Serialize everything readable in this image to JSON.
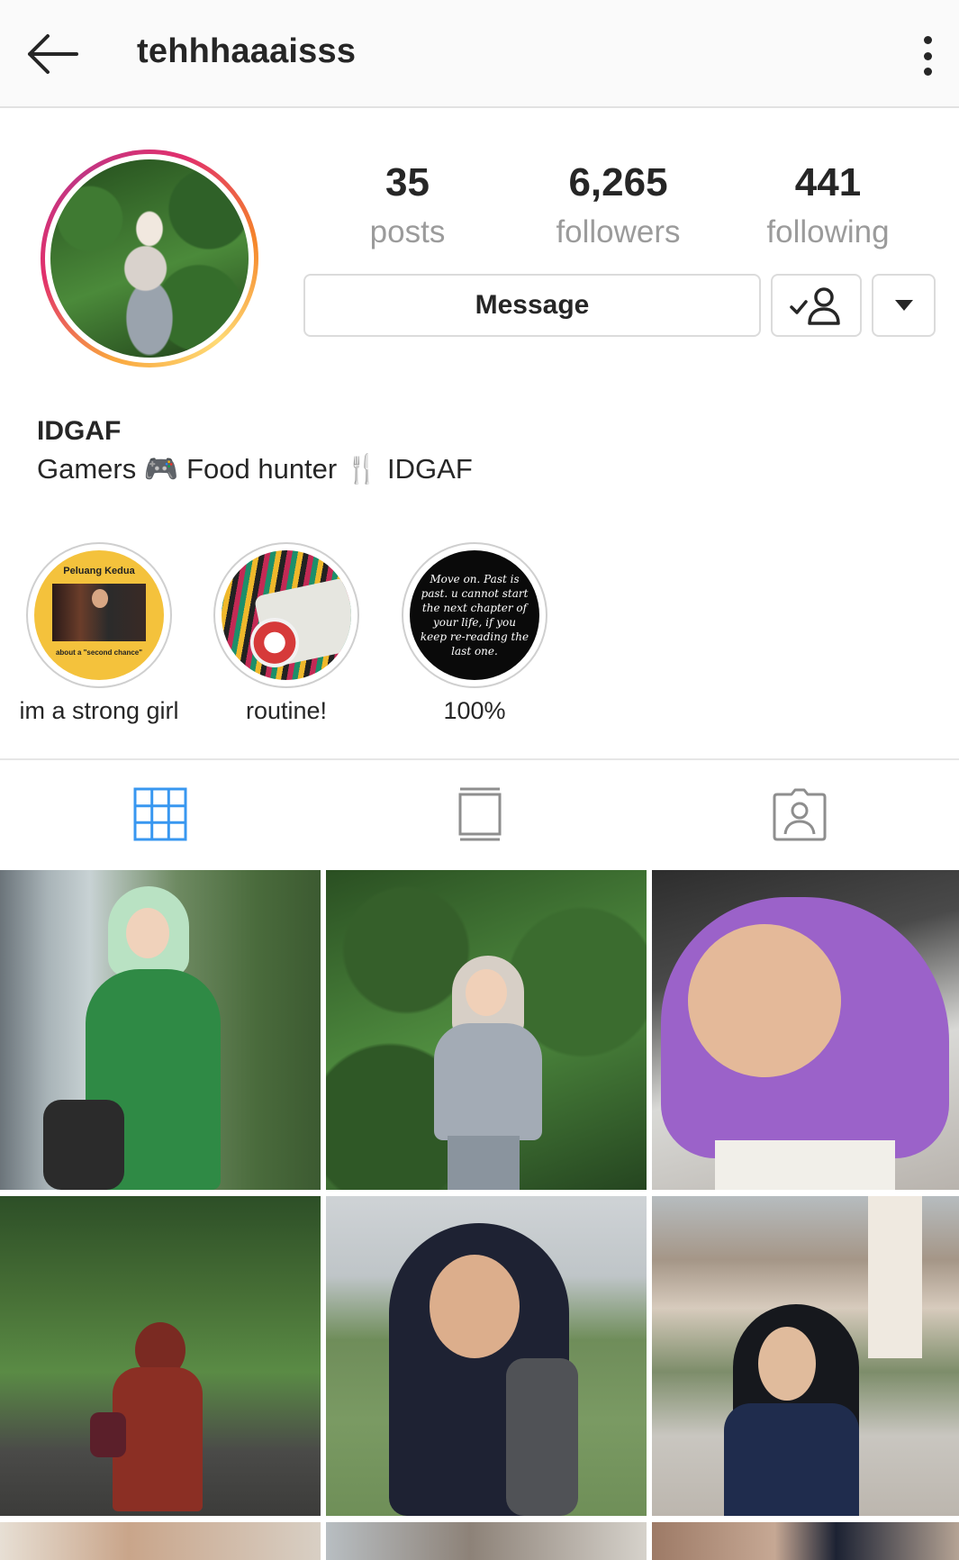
{
  "header": {
    "username": "tehhhaaaisss",
    "back_icon": "arrow-left-icon",
    "more_icon": "more-vertical-icon"
  },
  "profile": {
    "stats": [
      {
        "value": "35",
        "label": "posts"
      },
      {
        "value": "6,265",
        "label": "followers"
      },
      {
        "value": "441",
        "label": "following"
      }
    ],
    "message_label": "Message",
    "following_icon": "person-check-icon",
    "dropdown_icon": "caret-down-icon",
    "name": "IDGAF",
    "bio": "Gamers 🎮 Food hunter 🍴 IDGAF"
  },
  "highlights": [
    {
      "label": "im a strong girl",
      "cover_title": "Peluang Kedua",
      "cover_caption": "about a \"second chance\""
    },
    {
      "label": "routine!"
    },
    {
      "label": "100%",
      "cover_text": "Move on. Past is past. u cannot start the next chapter of your life, if you keep re-reading the last one."
    }
  ],
  "tabs": [
    {
      "name": "grid",
      "icon": "grid-icon",
      "active": true
    },
    {
      "name": "feed",
      "icon": "feed-icon",
      "active": false
    },
    {
      "name": "tagged",
      "icon": "tagged-person-icon",
      "active": false
    }
  ],
  "colors": {
    "active_tab": "#3897f0",
    "inactive_tab": "#8e8e8e",
    "ring_start": "#f9a73e",
    "ring_end": "#c13584"
  }
}
